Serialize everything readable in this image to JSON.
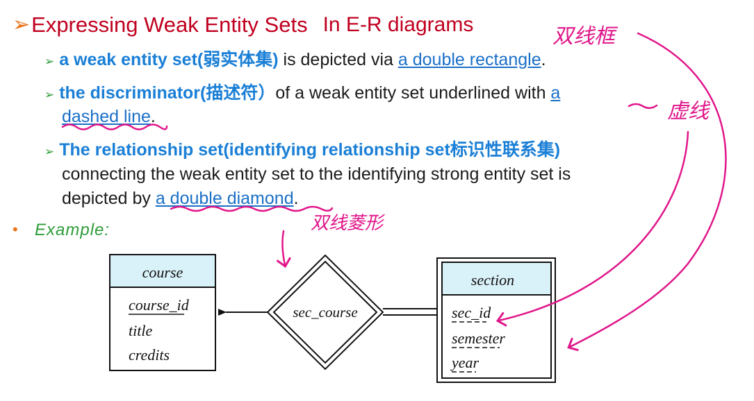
{
  "title": {
    "bullet": "➢",
    "main": "Expressing Weak Entity Sets",
    "sub": "In E-R diagrams"
  },
  "bullets": [
    {
      "arrow": "➢",
      "bold": "a weak entity set(弱实体集)",
      "text": " is depicted via ",
      "link": "a double rectangle",
      "tail": "."
    },
    {
      "arrow": "➢",
      "bold": "the discriminator(描述符）",
      "text": "of a weak entity set underlined with ",
      "link_a": "a",
      "link_b": "dashed line",
      "tail": "."
    },
    {
      "arrow": "➢",
      "bold": "The relationship set(identifying relationship set标识性联系集)",
      "line2": "connecting the  weak entity set to the identifying strong entity set is",
      "line3_prefix": "depicted by ",
      "link": "a double diamond",
      "tail": "."
    }
  ],
  "example": {
    "bullet": "•",
    "label": "Example:"
  },
  "diagram": {
    "course": {
      "title": "course",
      "attrs": [
        "course_id",
        "title",
        "credits"
      ]
    },
    "relationship": "sec_course",
    "section": {
      "title": "section",
      "attrs": [
        "sec_id",
        "semester",
        "year"
      ]
    }
  },
  "annotations": {
    "double_rect": "双线框",
    "dashed": "虚线",
    "double_diamond": "双线菱形"
  },
  "colors": {
    "title": "#c0001f",
    "accent_orange": "#e8731a",
    "bullet_green": "#2e9c3a",
    "bold_blue": "#1a7fd6",
    "link_blue": "#1a6fc7",
    "entity_header": "#d9f1f8",
    "annotation_pink": "#e0168a"
  }
}
